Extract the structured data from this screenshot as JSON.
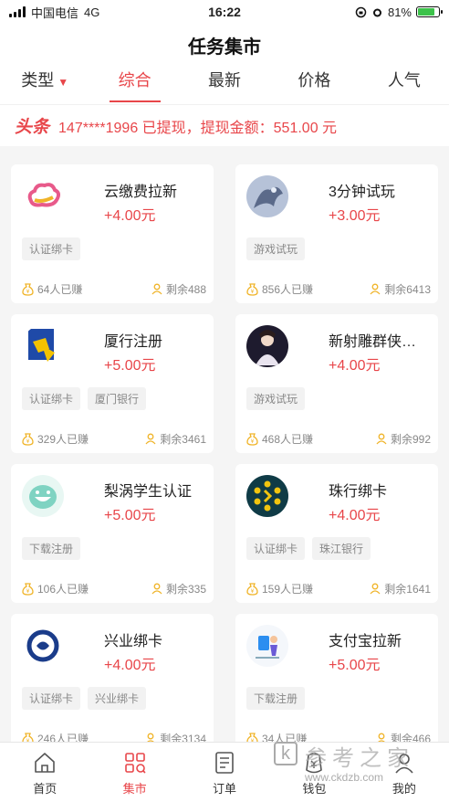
{
  "status_bar": {
    "carrier": "中国电信",
    "network": "4G",
    "time": "16:22",
    "battery": "81%",
    "battery_level": 0.81
  },
  "header": {
    "title": "任务集市"
  },
  "tabs": [
    {
      "label": "类型",
      "has_caret": true
    },
    {
      "label": "综合",
      "active": true
    },
    {
      "label": "最新"
    },
    {
      "label": "价格"
    },
    {
      "label": "人气"
    }
  ],
  "ticker": {
    "tag": "头条",
    "text": "147****1996 已提现，提现金额：551.00 元"
  },
  "cards": [
    {
      "name": "云缴费拉新",
      "price": "+4.00元",
      "tags": [
        "认证绑卡"
      ],
      "earned": "64人已赚",
      "remaining": "剩余488",
      "logo": "cloud-logo-icon"
    },
    {
      "name": "3分钟试玩",
      "price": "+3.00元",
      "tags": [
        "游戏试玩"
      ],
      "earned": "856人已赚",
      "remaining": "剩余6413",
      "logo": "dragon-game-logo-icon"
    },
    {
      "name": "厦行注册",
      "price": "+5.00元",
      "tags": [
        "认证绑卡",
        "厦门银行"
      ],
      "earned": "329人已赚",
      "remaining": "剩余3461",
      "logo": "xiamen-bank-logo-icon"
    },
    {
      "name": "新射雕群侠…",
      "price": "+4.00元",
      "tags": [
        "游戏试玩"
      ],
      "earned": "468人已赚",
      "remaining": "剩余992",
      "logo": "wuxia-game-logo-icon"
    },
    {
      "name": "梨涡学生认证",
      "price": "+5.00元",
      "tags": [
        "下载注册"
      ],
      "earned": "106人已赚",
      "remaining": "剩余335",
      "logo": "liwo-smile-logo-icon"
    },
    {
      "name": "珠行绑卡",
      "price": "+4.00元",
      "tags": [
        "认证绑卡",
        "珠江银行"
      ],
      "earned": "159人已赚",
      "remaining": "剩余1641",
      "logo": "pearl-bank-logo-icon"
    },
    {
      "name": "兴业绑卡",
      "price": "+4.00元",
      "tags": [
        "认证绑卡",
        "兴业绑卡"
      ],
      "earned": "246人已赚",
      "remaining": "剩余3134",
      "logo": "industrial-bank-logo-icon"
    },
    {
      "name": "支付宝拉新",
      "price": "+5.00元",
      "tags": [
        "下载注册"
      ],
      "earned": "34人已赚",
      "remaining": "剩余466",
      "logo": "alipay-promo-logo-icon"
    }
  ],
  "bottom_nav": [
    {
      "label": "首页",
      "icon": "home-icon"
    },
    {
      "label": "集市",
      "icon": "market-grid-icon",
      "active": true
    },
    {
      "label": "订单",
      "icon": "order-list-icon"
    },
    {
      "label": "钱包",
      "icon": "wallet-icon"
    },
    {
      "label": "我的",
      "icon": "profile-icon"
    }
  ],
  "watermark": {
    "letter": "k",
    "text": "参考之家",
    "url": "www.ckdzb.com"
  },
  "colors": {
    "accent": "#e8464a",
    "tag_bg": "#f2f2f2",
    "coin": "#f0b429"
  }
}
